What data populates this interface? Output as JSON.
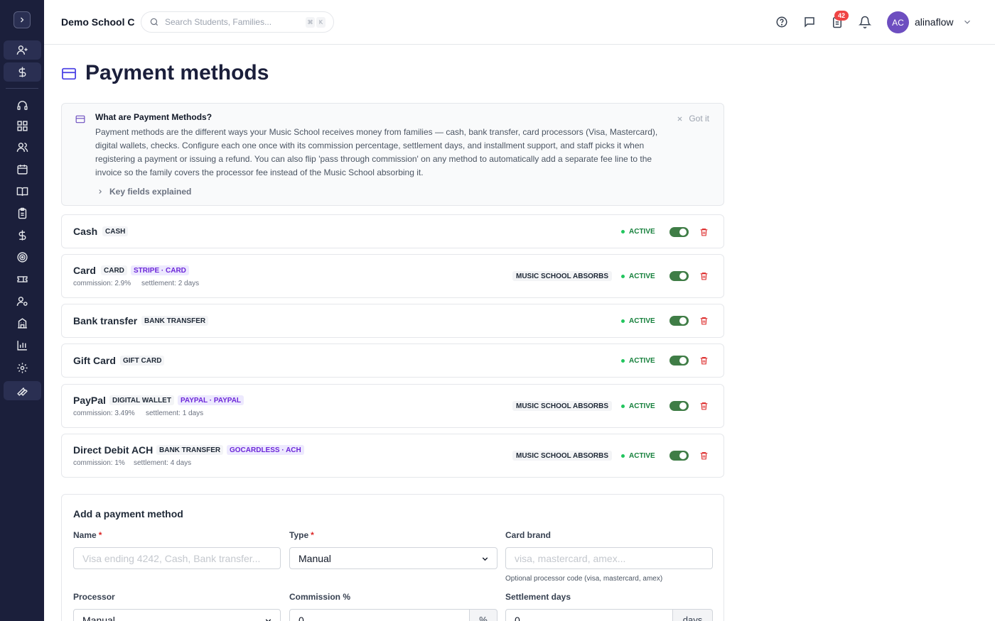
{
  "header": {
    "school_name": "Demo School C",
    "search_placeholder": "Search Students, Families...",
    "kbd_cmd": "⌘",
    "kbd_k": "K",
    "notifications_count": "42",
    "avatar_initials": "AC",
    "username": "alinaflow"
  },
  "page": {
    "title": "Payment methods"
  },
  "info": {
    "title": "What are Payment Methods?",
    "text": "Payment methods are the different ways your Music School receives money from families — cash, bank transfer, card processors (Visa, Mastercard), digital wallets, checks. Configure each one once with its commission percentage, settlement days, and installment support, and staff picks it when registering a payment or issuing a refund. You can also flip 'pass through commission' on any method to automatically add a separate fee line to the invoice so the family covers the processor fee instead of the Music School absorbing it.",
    "dismiss_label": "Got it",
    "key_fields_label": "Key fields explained"
  },
  "methods": [
    {
      "name": "Cash",
      "type_tag": "CASH",
      "status": "ACTIVE"
    },
    {
      "name": "Card",
      "type_tag": "CARD",
      "processor_tag": "STRIPE · CARD",
      "commission": "commission: 2.9%",
      "settlement": "settlement: 2 days",
      "absorb_label": "MUSIC SCHOOL ABSORBS",
      "status": "ACTIVE"
    },
    {
      "name": "Bank transfer",
      "type_tag": "BANK TRANSFER",
      "status": "ACTIVE"
    },
    {
      "name": "Gift Card",
      "type_tag": "GIFT CARD",
      "status": "ACTIVE"
    },
    {
      "name": "PayPal",
      "type_tag": "DIGITAL WALLET",
      "processor_tag": "PAYPAL · PAYPAL",
      "commission": "commission: 3.49%",
      "settlement": "settlement: 1 days",
      "absorb_label": "MUSIC SCHOOL ABSORBS",
      "status": "ACTIVE"
    },
    {
      "name": "Direct Debit ACH",
      "type_tag": "BANK TRANSFER",
      "processor_tag": "GOCARDLESS · ACH",
      "commission": "commission: 1%",
      "settlement": "settlement: 4 days",
      "absorb_label": "MUSIC SCHOOL ABSORBS",
      "status": "ACTIVE"
    }
  ],
  "add_form": {
    "title": "Add a payment method",
    "name_label": "Name",
    "required_mark": "*",
    "name_placeholder": "Visa ending 4242, Cash, Bank transfer...",
    "type_label": "Type",
    "type_value": "Manual",
    "card_brand_label": "Card brand",
    "card_brand_placeholder": "visa, mastercard, amex...",
    "card_brand_help": "Optional processor code (visa, mastercard, amex)",
    "processor_label": "Processor",
    "processor_value": "Manual",
    "commission_label": "Commission %",
    "commission_value": "0",
    "commission_suffix": "%",
    "settlement_label": "Settlement days",
    "settlement_value": "0",
    "settlement_suffix": "days"
  },
  "colors": {
    "sidebar_bg": "#1b1f3b",
    "accent": "#6d4ec0",
    "active_green": "#16803c",
    "toggle_on": "#3f7d46",
    "danger": "#dc2626"
  }
}
